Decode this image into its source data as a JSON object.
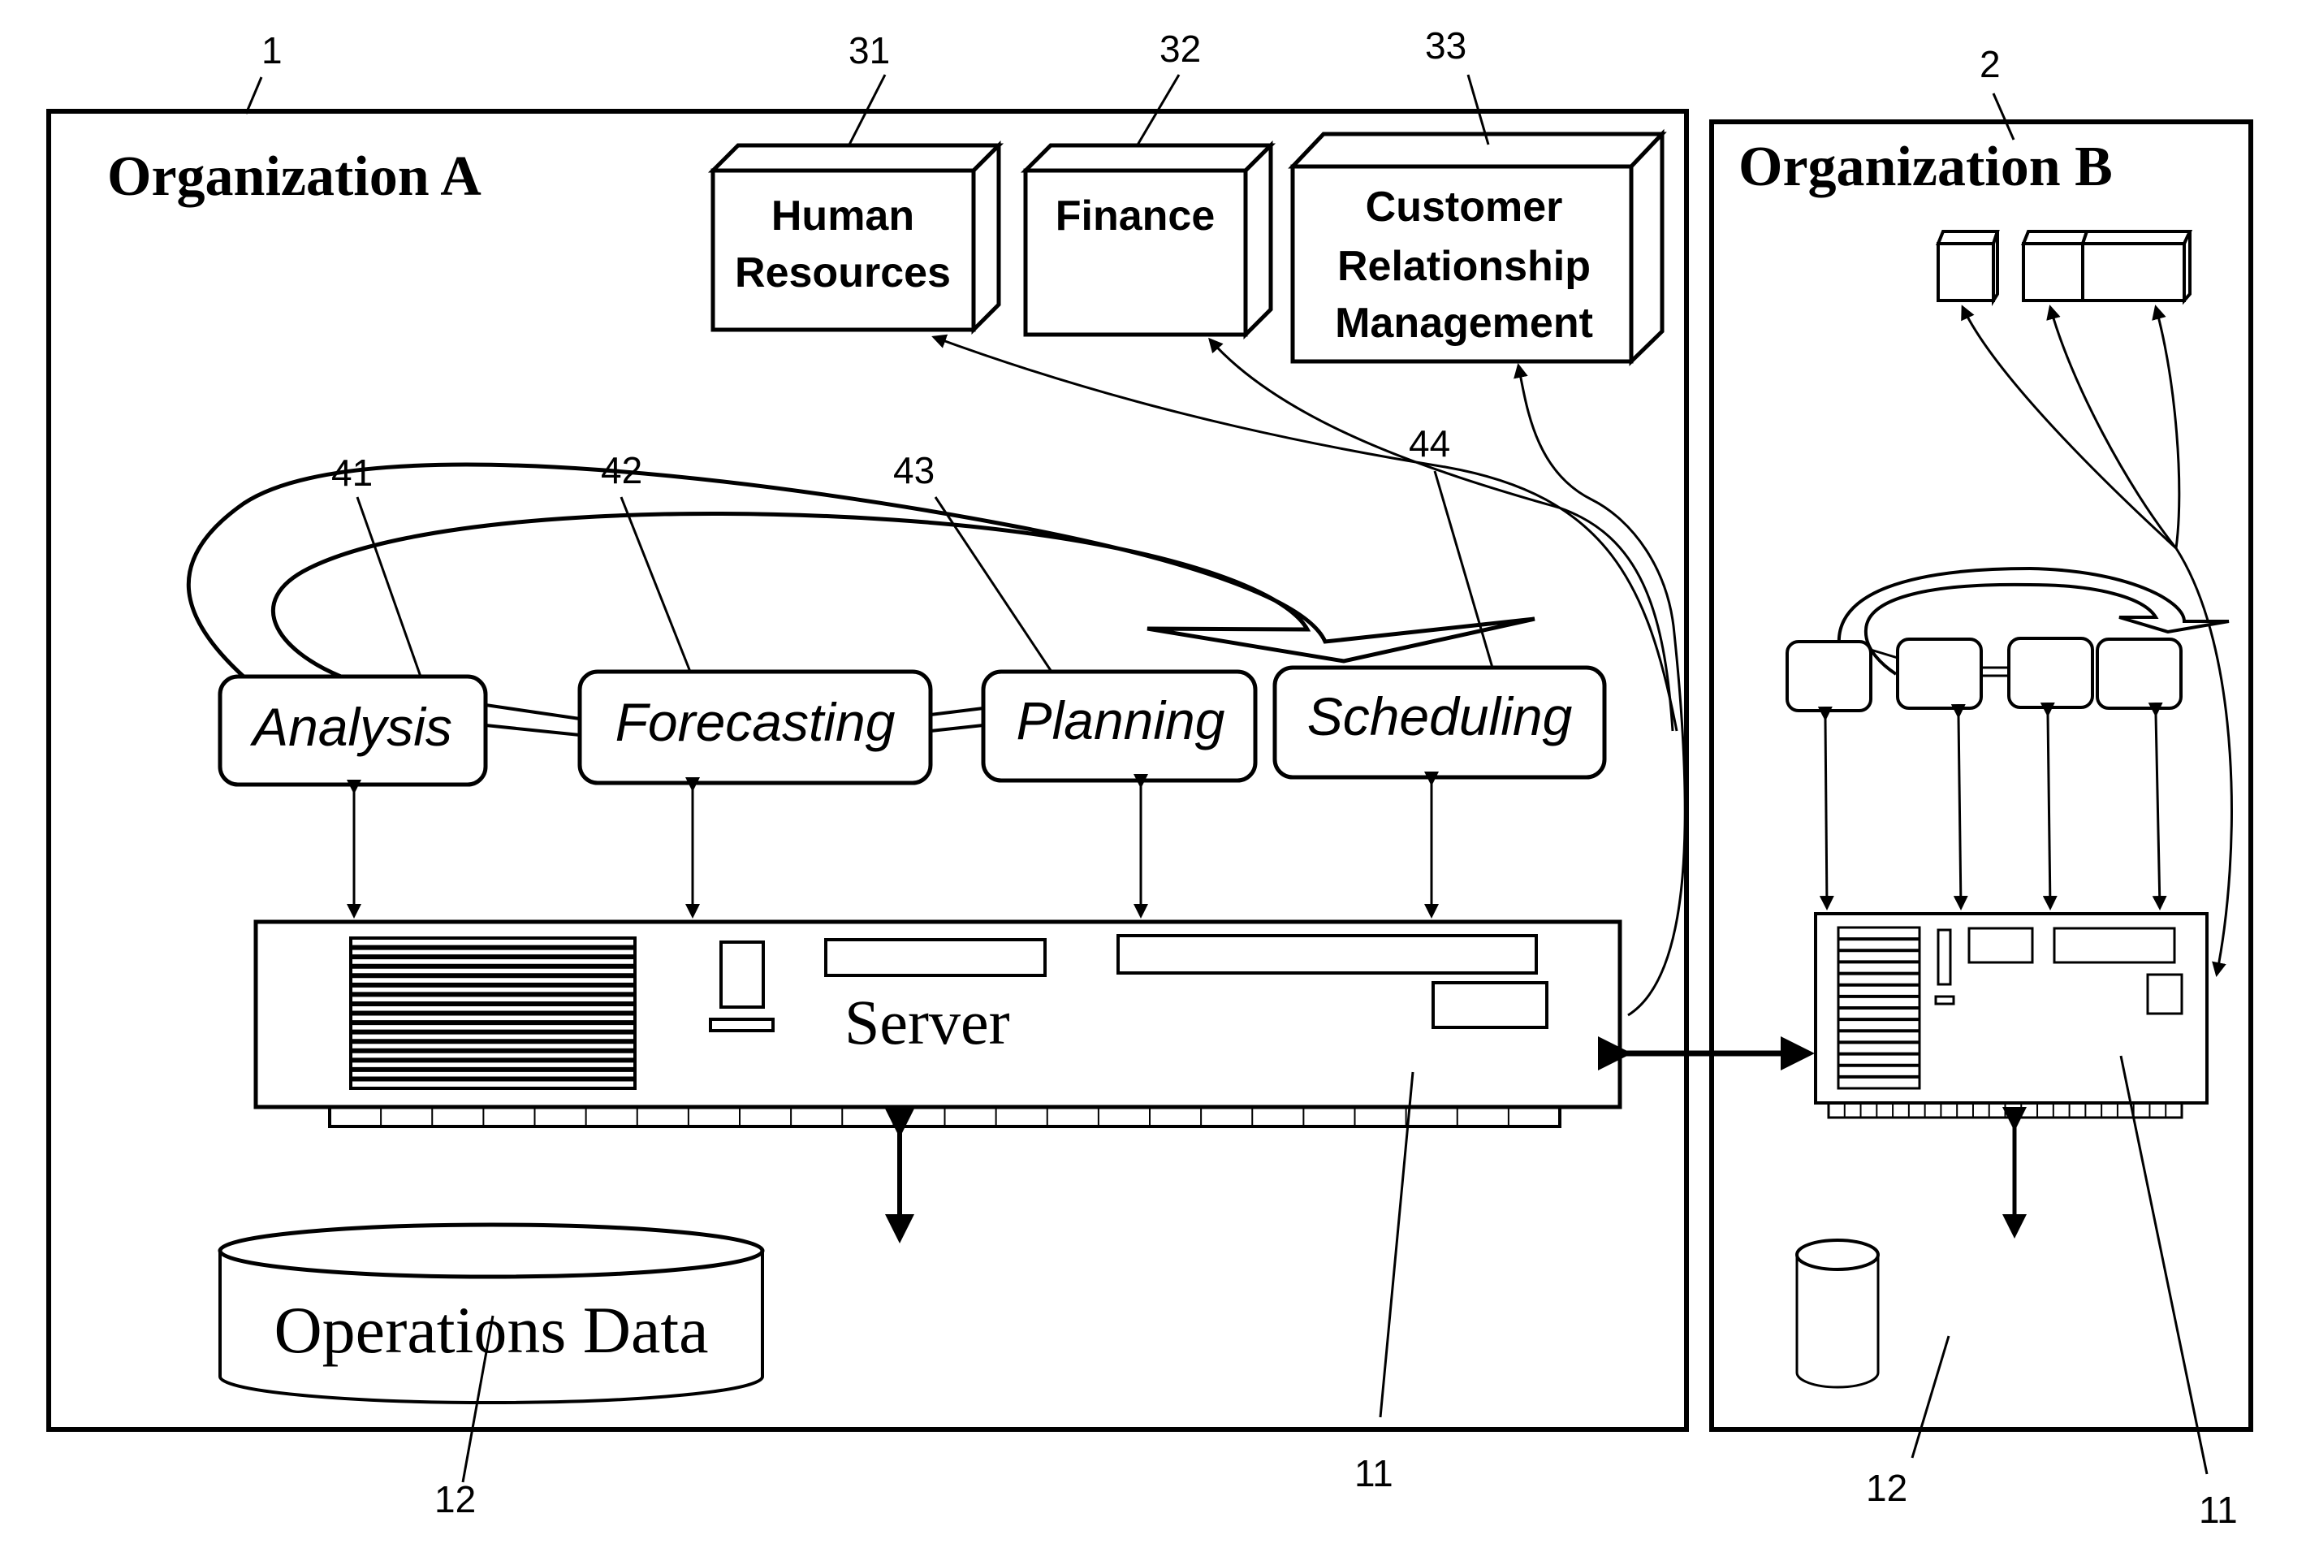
{
  "figure": {
    "organizations": [
      {
        "ref": "1",
        "title": "Organization A"
      },
      {
        "ref": "2",
        "title": "Organization B"
      }
    ],
    "modules": [
      {
        "ref": "31",
        "lines": [
          "Human",
          "Resources"
        ]
      },
      {
        "ref": "32",
        "lines": [
          "Finance"
        ]
      },
      {
        "ref": "33",
        "lines": [
          "Customer",
          "Relationship",
          "Management"
        ]
      }
    ],
    "processes": [
      {
        "ref": "41",
        "label": "Analysis"
      },
      {
        "ref": "42",
        "label": "Forecasting"
      },
      {
        "ref": "43",
        "label": "Planning"
      },
      {
        "ref": "44",
        "label": "Scheduling"
      }
    ],
    "server": {
      "label": "Server",
      "ref_a": "11",
      "ref_b": "11"
    },
    "database": {
      "label": "Operations Data",
      "ref_a": "12",
      "ref_b": "12"
    }
  }
}
